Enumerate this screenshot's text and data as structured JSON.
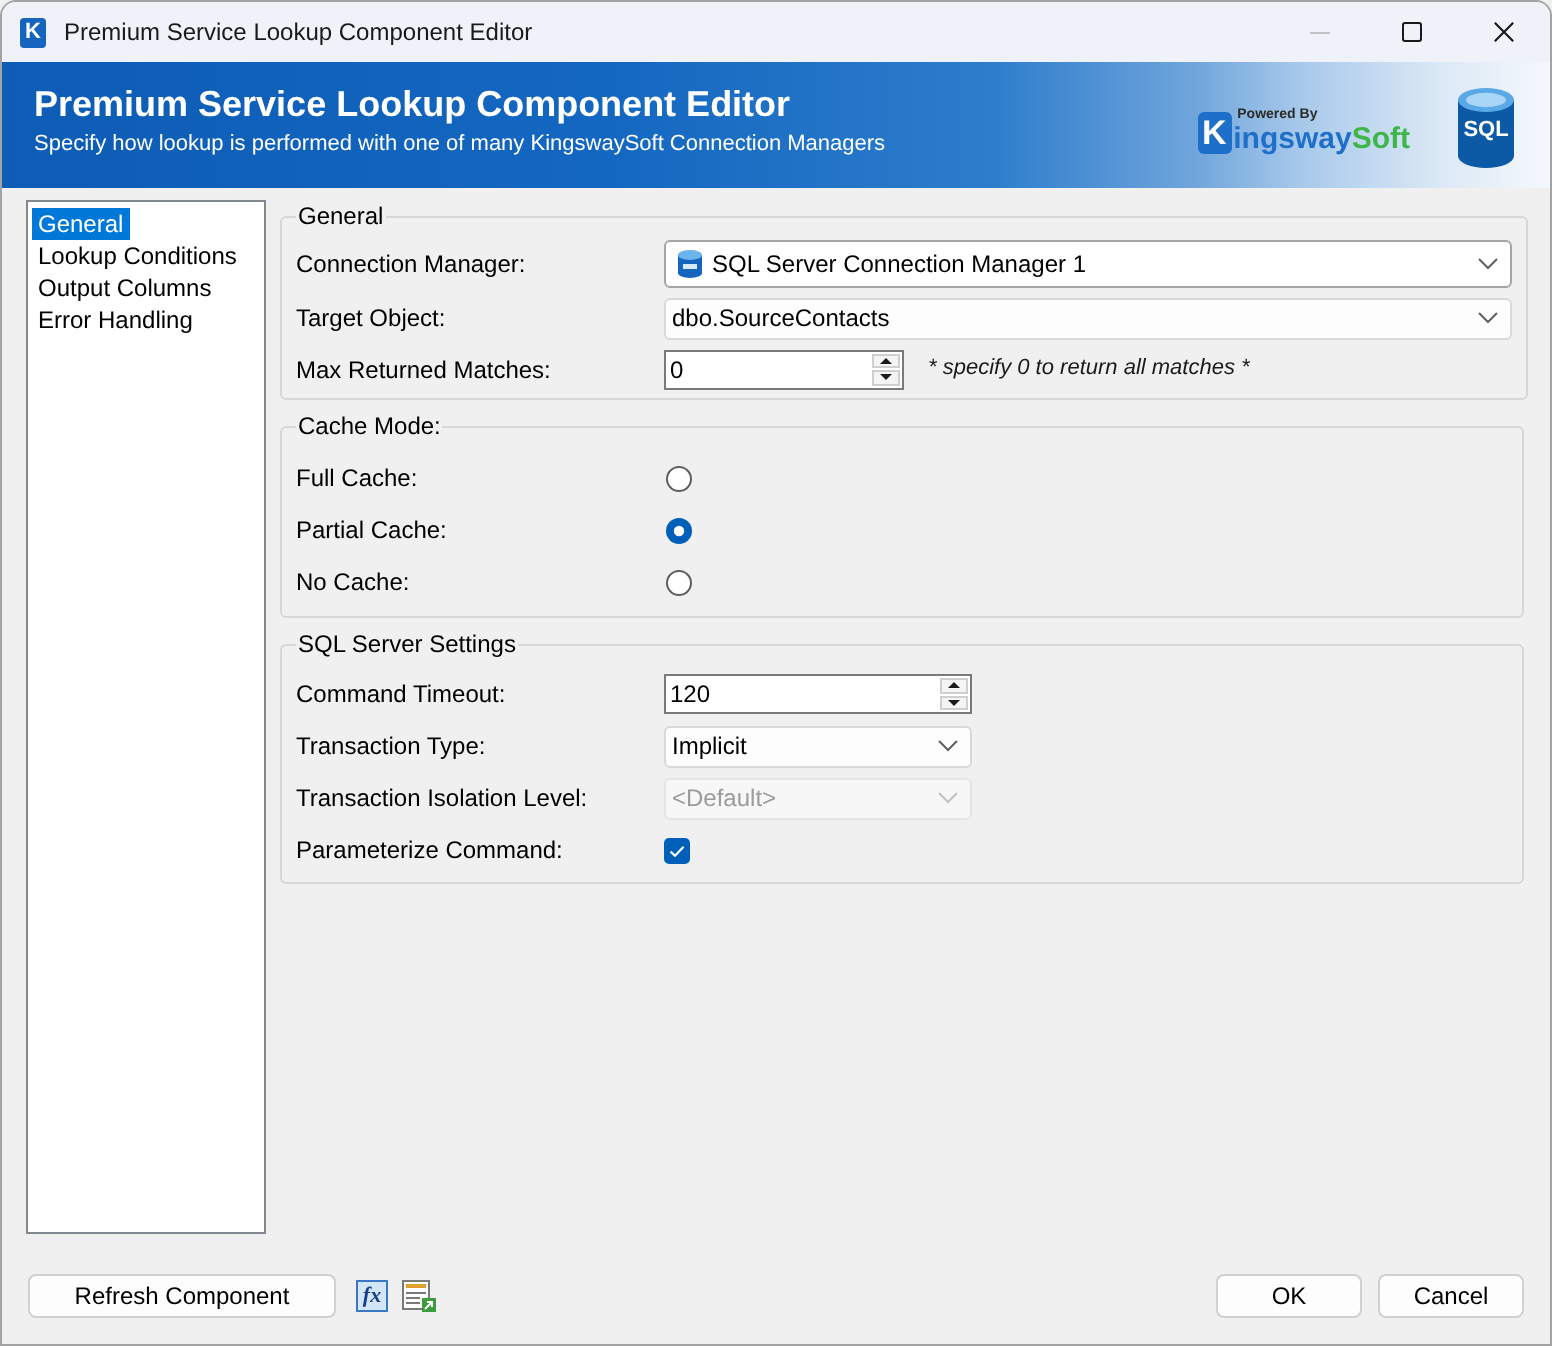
{
  "window": {
    "app_icon_letter": "K",
    "title": "Premium Service Lookup Component Editor",
    "controls": [
      {
        "kind": "minimize",
        "disabled": true
      },
      {
        "kind": "maximize",
        "disabled": false
      },
      {
        "kind": "close",
        "disabled": false
      }
    ]
  },
  "header": {
    "title": "Premium Service Lookup Component Editor",
    "subtitle": "Specify how lookup is performed with one of many KingswaySoft Connection Managers",
    "logo": {
      "caption": "Powered By",
      "initial": "K",
      "name_first": "ingsway",
      "name_second": "Soft"
    },
    "database_badge": "SQL"
  },
  "sidebar": {
    "items": [
      {
        "label": "General",
        "selected": true
      },
      {
        "label": "Lookup Conditions",
        "selected": false
      },
      {
        "label": "Output Columns",
        "selected": false
      },
      {
        "label": "Error Handling",
        "selected": false
      }
    ]
  },
  "groups": [
    {
      "title": "General",
      "rows": [
        {
          "kind": "icon_combo",
          "label": "Connection Manager:",
          "value": "SQL Server Connection Manager 1",
          "disabled": false
        },
        {
          "kind": "combo",
          "label": "Target Object:",
          "value": "dbo.SourceContacts",
          "disabled": false
        },
        {
          "kind": "spin",
          "label": "Max Returned Matches:",
          "value": "0",
          "hint": "* specify 0 to return all matches *"
        }
      ]
    },
    {
      "title": "Cache Mode:",
      "rows": [
        {
          "kind": "radio",
          "label": "Full Cache:",
          "selected": false
        },
        {
          "kind": "radio",
          "label": "Partial Cache:",
          "selected": true
        },
        {
          "kind": "radio",
          "label": "No Cache:",
          "selected": false
        }
      ]
    },
    {
      "title": "SQL Server Settings",
      "rows": [
        {
          "kind": "spin",
          "label": "Command Timeout:",
          "value": "120"
        },
        {
          "kind": "combo",
          "label": "Transaction Type:",
          "value": "Implicit",
          "disabled": false
        },
        {
          "kind": "combo",
          "label": "Transaction Isolation Level:",
          "value": "<Default>",
          "disabled": true
        },
        {
          "kind": "checkbox",
          "label": "Parameterize Command:",
          "checked": true
        }
      ]
    }
  ],
  "footer": {
    "refresh_button": "Refresh Component",
    "tools": [
      {
        "kind": "expression",
        "label": "fx"
      },
      {
        "kind": "table"
      }
    ],
    "buttons": [
      "OK",
      "Cancel"
    ]
  }
}
